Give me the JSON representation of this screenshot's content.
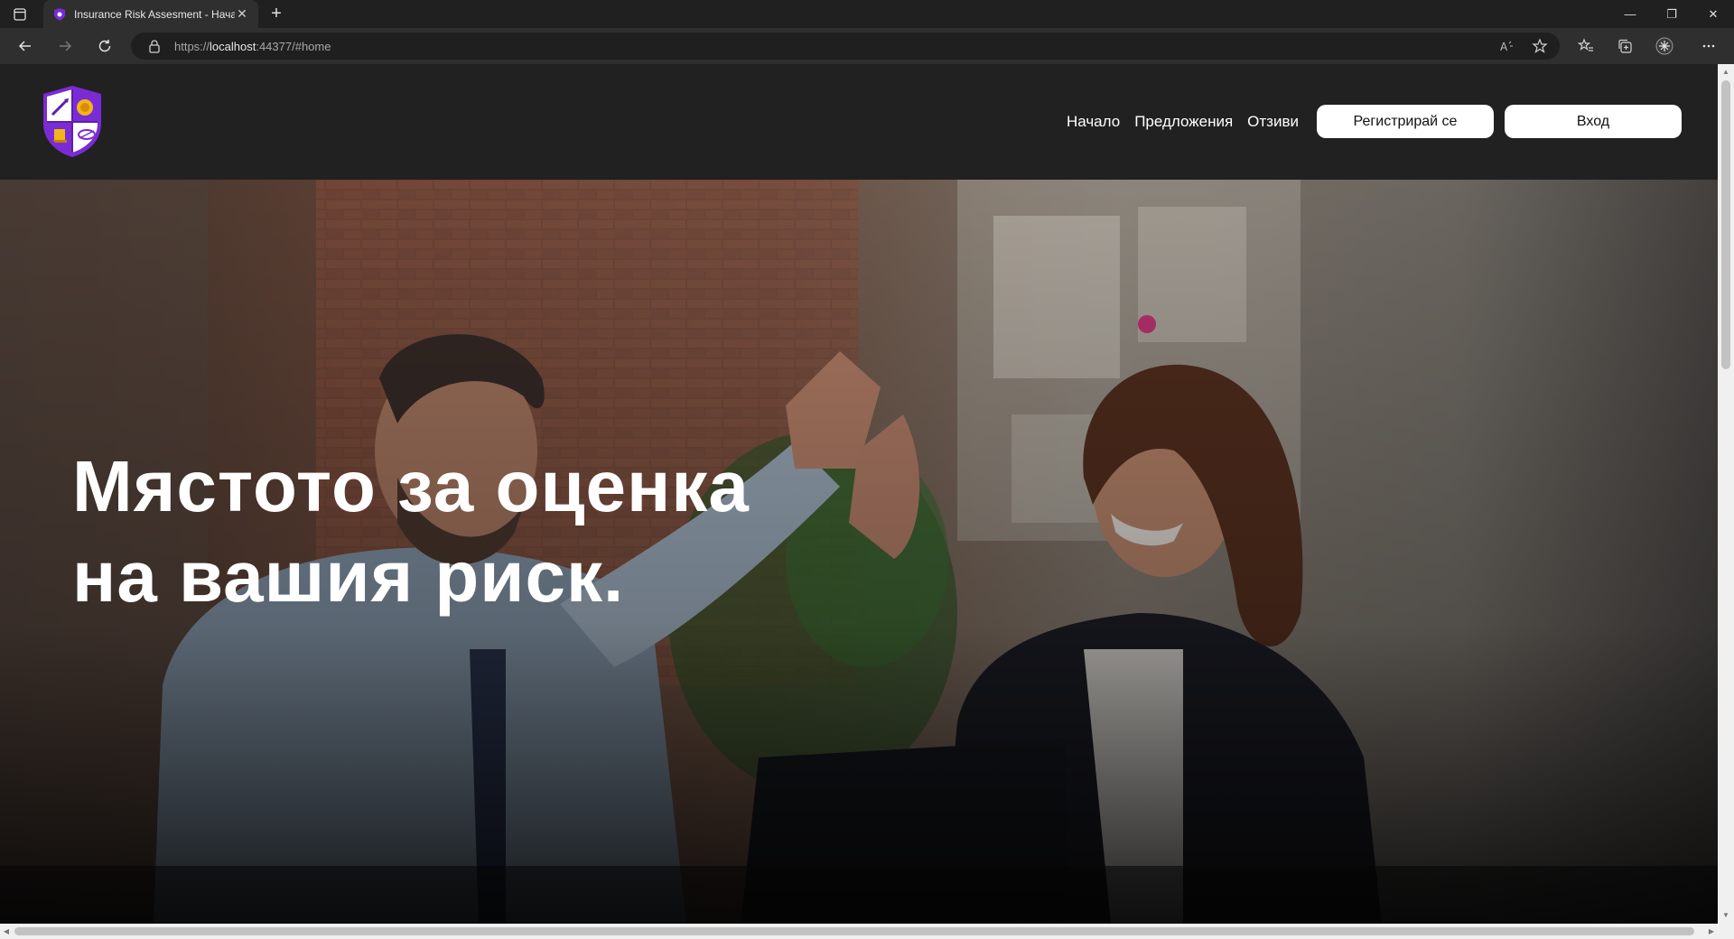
{
  "browser": {
    "tab": {
      "title": "Insurance Risk Assesment - Нача"
    },
    "address": {
      "scheme": "https://",
      "host": "localhost",
      "rest": ":44377/#home"
    },
    "window_controls": {
      "minimize": "—",
      "restore": "❐",
      "close": "✕"
    }
  },
  "site": {
    "nav": {
      "home": "Начало",
      "offers": "Предложения",
      "reviews": "Отзиви",
      "register": "Регистрирай се",
      "login": "Вход"
    },
    "hero": {
      "line1": "Мястото за оценка",
      "line2": "на вашия риск."
    }
  },
  "colors": {
    "header_bg": "#212121",
    "logo_purple": "#7b2bd6",
    "logo_gold": "#f3b41a"
  },
  "icons": {
    "back": "back-arrow-icon",
    "forward": "forward-arrow-icon",
    "refresh": "refresh-icon",
    "lock": "lock-icon",
    "read_aloud": "read-aloud-icon",
    "favorite": "add-favorite-icon",
    "favorites": "favorites-icon",
    "collections": "collections-icon",
    "extensions": "extensions-icon",
    "menu": "more-icon"
  }
}
